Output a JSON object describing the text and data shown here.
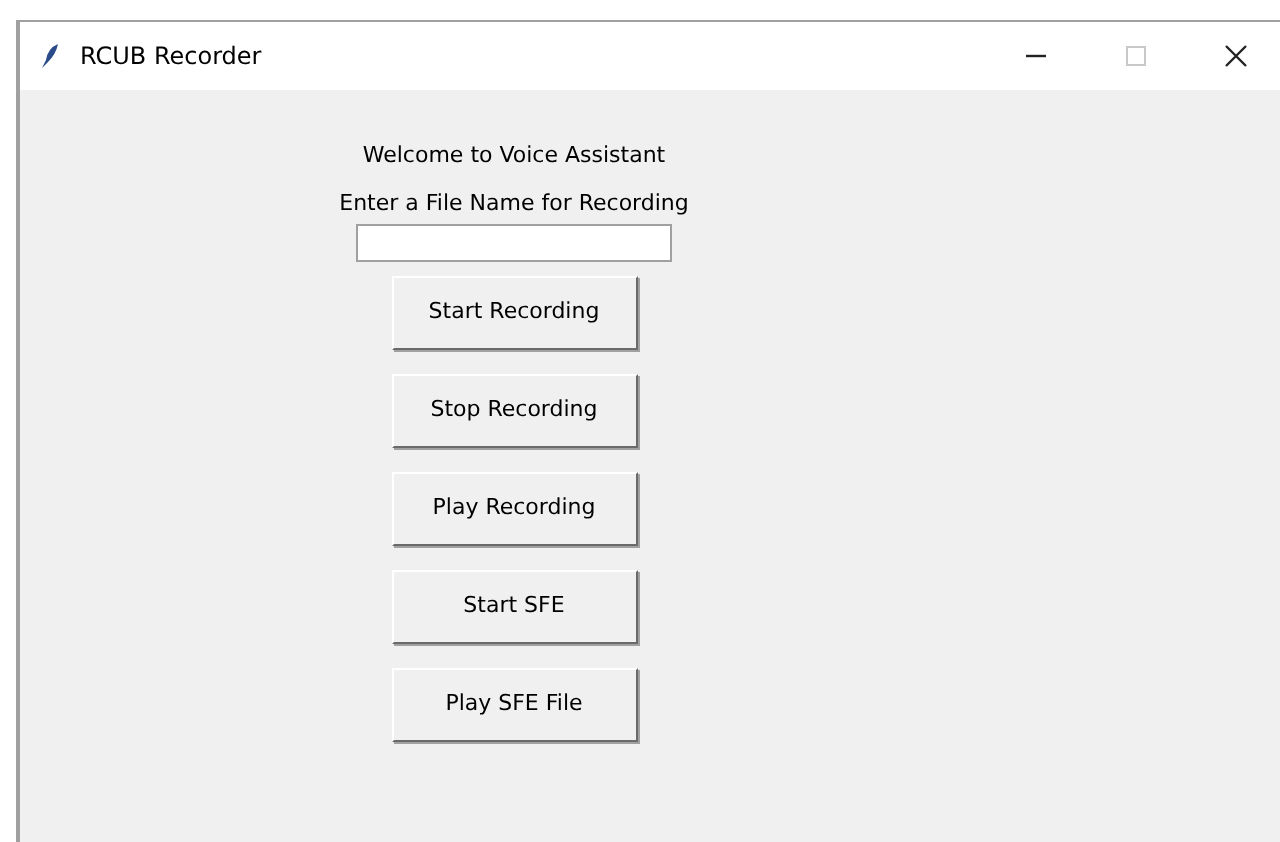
{
  "window": {
    "title": "RCUB Recorder",
    "maximize_disabled": true
  },
  "labels": [
    "Welcome to Voice Assistant",
    "Enter a File Name for Recording"
  ],
  "buttons": [
    "Start Recording",
    "Stop Recording",
    "Play Recording",
    "Start SFE",
    "Play SFE File"
  ]
}
